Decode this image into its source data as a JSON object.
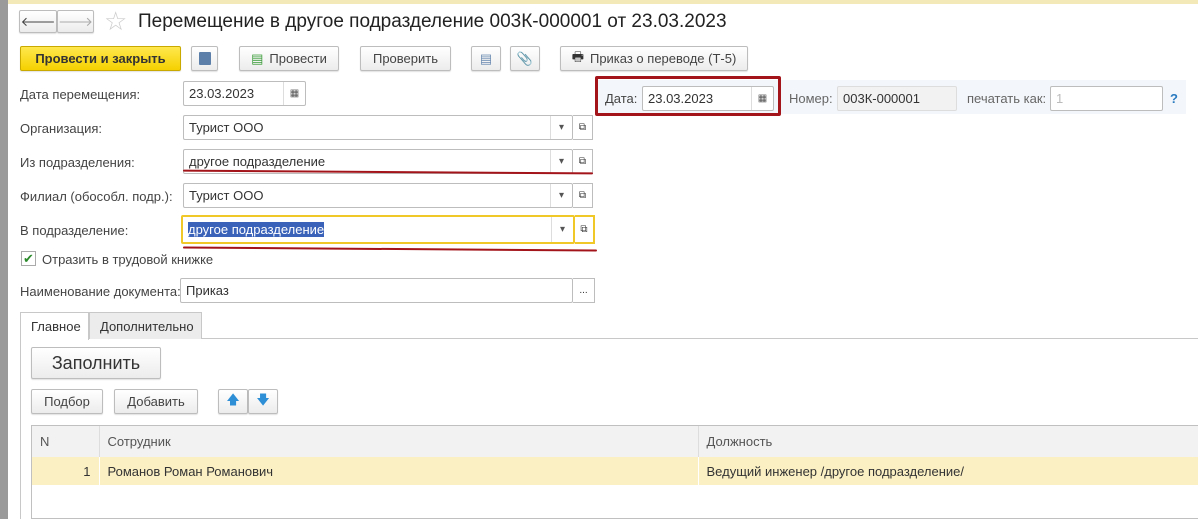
{
  "title": "Перемещение в другое подразделение 003К-000001 от 23.03.2023",
  "toolbar": {
    "post_close": "Провести и закрыть",
    "post": "Провести",
    "check": "Проверить",
    "print_order": "Приказ о переводе (Т-5)"
  },
  "header": {
    "date_label": "Дата:",
    "date": "23.03.2023",
    "number_label": "Номер:",
    "number": "003К-000001",
    "print_as_label": "печатать как:",
    "print_as_placeholder": "1",
    "help": "?"
  },
  "form": {
    "move_date_label": "Дата перемещения:",
    "move_date": "23.03.2023",
    "org_label": "Организация:",
    "org": "Турист ООО",
    "from_label": "Из подразделения:",
    "from": "другое подразделение",
    "branch_label": "Филиал (обособл. подр.):",
    "branch": "Турист ООО",
    "to_label": "В подразделение:",
    "to": "другое подразделение",
    "workbook_label": "Отразить в трудовой книжке",
    "workbook_checked": true,
    "docname_label": "Наименование документа:",
    "docname": "Приказ"
  },
  "tabs": [
    "Главное",
    "Дополнительно"
  ],
  "main": {
    "fill": "Заполнить",
    "select": "Подбор",
    "add": "Добавить"
  },
  "table": {
    "columns": [
      "N",
      "Сотрудник",
      "Должность"
    ],
    "rows": [
      {
        "n": "1",
        "employee": "Романов Роман Романович",
        "position": "Ведущий инженер /другое подразделение/"
      }
    ]
  }
}
